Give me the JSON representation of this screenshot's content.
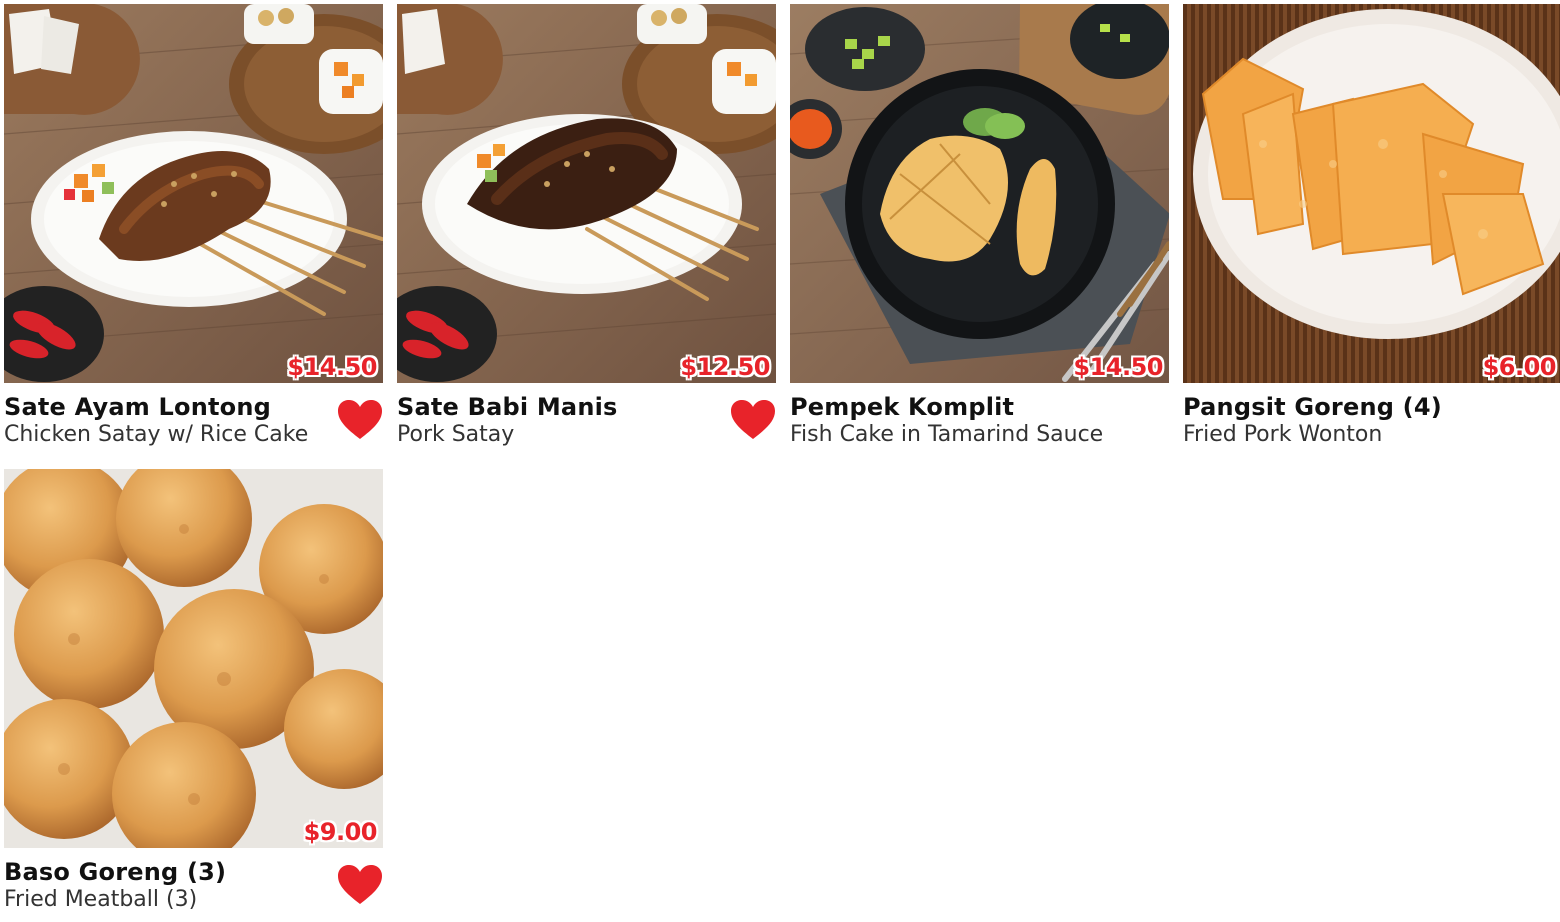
{
  "colors": {
    "price": "#e8232a",
    "heart": "#e8232a",
    "title": "#111111",
    "subtitle": "#333333"
  },
  "items": [
    {
      "name": "Sate Ayam Lontong",
      "description": "Chicken Satay w/ Rice Cake",
      "price": "$14.50",
      "favorite": true,
      "icon": "heart-icon"
    },
    {
      "name": "Sate Babi Manis",
      "description": "Pork Satay",
      "price": "$12.50",
      "favorite": true,
      "icon": "heart-icon"
    },
    {
      "name": "Pempek Komplit",
      "description": "Fish Cake in Tamarind Sauce",
      "price": "$14.50",
      "favorite": false
    },
    {
      "name": "Pangsit Goreng (4)",
      "description": "Fried Pork Wonton",
      "price": "$6.00",
      "favorite": false
    },
    {
      "name": "Baso Goreng (3)",
      "description": "Fried Meatball (3)",
      "price": "$9.00",
      "favorite": true,
      "icon": "heart-icon"
    }
  ]
}
